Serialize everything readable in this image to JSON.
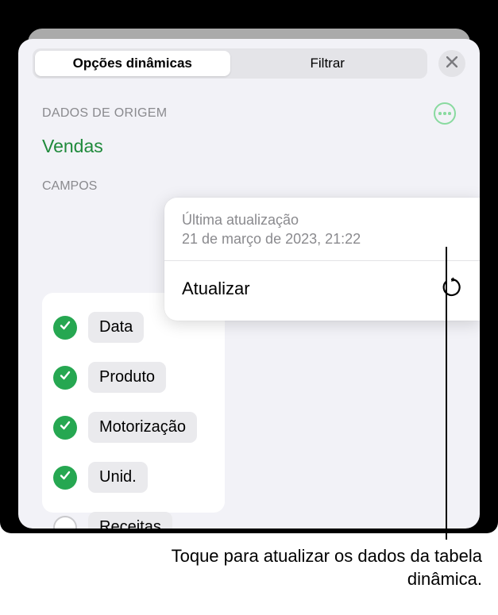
{
  "tabs": {
    "dynamic": "Opções dinâmicas",
    "filter": "Filtrar"
  },
  "source": {
    "sectionTitle": "DADOS DE ORIGEM",
    "name": "Vendas"
  },
  "fields": {
    "sectionTitle": "CAMPOS",
    "items": [
      {
        "label": "Data",
        "checked": true
      },
      {
        "label": "Produto",
        "checked": true
      },
      {
        "label": "Motorização",
        "checked": true
      },
      {
        "label": "Unid.",
        "checked": true
      },
      {
        "label": "Receitas",
        "checked": false
      }
    ]
  },
  "popover": {
    "updateLabel": "Última atualização",
    "updateTime": "21 de março de 2023, 21:22",
    "action": "Atualizar"
  },
  "callout": "Toque para atualizar os dados da tabela dinâmica."
}
